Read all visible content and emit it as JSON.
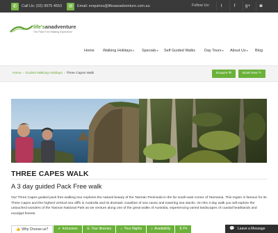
{
  "topbar": {
    "phone": "Call Us: (02) 9975 4553",
    "email": "Email: enquiries@lifesanadventure.com.au",
    "follow_label": "Follow Us:",
    "social": [
      "twitter-icon",
      "facebook-icon",
      "google-plus-icon",
      "instagram-icon"
    ]
  },
  "logo": {
    "name_prefix": "life's",
    "name_suffix": "anadventure",
    "tagline": "The Pack Free Walking Experience"
  },
  "nav": {
    "items": [
      "Home",
      "Walking Holidays",
      "Specials",
      "Self Guided Walks",
      "Day Tours",
      "About Us",
      "Blog"
    ]
  },
  "breadcrumb": {
    "home": "Home",
    "section": "Guided Walking Holidays",
    "current": "Three Capes Walk"
  },
  "actions": {
    "enquire": "Enquire ✉",
    "book": "Book Now ✎"
  },
  "page": {
    "title": "THREE CAPES WALK",
    "subtitle": "A 3 day guided Pack Free walk",
    "body": "Our Three Capes guided pack free walking tour explores the natural beauty of the Tasman Peninsula in the far south-east corner of Tasmania. This region is famous for its Three Capes and the highest vertical sea cliffs in Australia and its dramatic coastline of sea caves and towering sea stacks. On this 3 day walk you will explore the untouched wonders of the Tasman National Park as we venture along one of the great walks of Australia, experiencing varied landscapes of coastal heathlands and eucalypt forests."
  },
  "tabs": [
    {
      "label": "Why Choose us?",
      "icon": "thumbs-up-icon",
      "active": true
    },
    {
      "label": "Inclusions",
      "icon": "check-icon",
      "active": false
    },
    {
      "label": "Tour Itinerary",
      "icon": "list-icon",
      "active": false
    },
    {
      "label": "Your Nights",
      "icon": "home-icon",
      "active": false
    },
    {
      "label": "Availability",
      "icon": "search-icon",
      "active": false
    },
    {
      "label": "Pri",
      "icon": "dollar-icon",
      "active": false
    }
  ],
  "chat": {
    "label": "Leave a Message"
  },
  "colors": {
    "accent": "#6bb13a",
    "topbar": "#3a3a3a",
    "chat": "#2f2f2f"
  }
}
